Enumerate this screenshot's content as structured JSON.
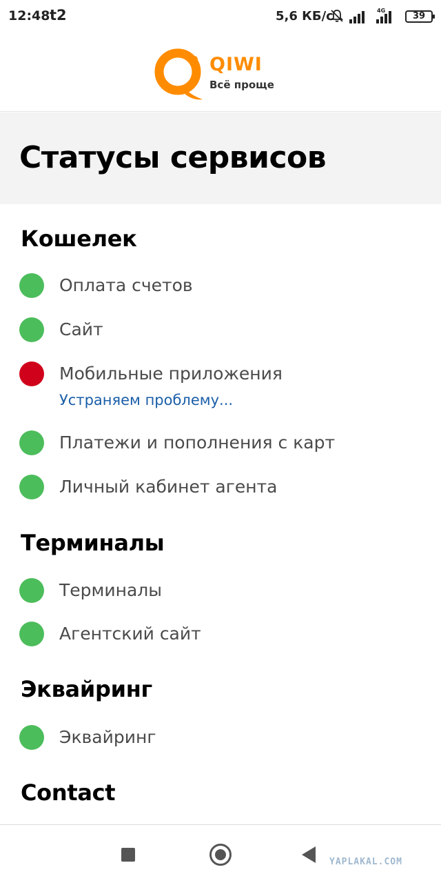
{
  "status_bar": {
    "time": "12:48",
    "carrier": "t2",
    "speed": "5,6 КБ/с",
    "network_label": "4G",
    "battery": "39"
  },
  "header": {
    "logo_word": "QIWI",
    "logo_slogan": "Всё проще",
    "brand_color": "#ff8c00"
  },
  "page": {
    "title": "Статусы сервисов"
  },
  "status_colors": {
    "ok": "#4cbd5b",
    "fail": "#d0021b",
    "note": "#1a5ea8"
  },
  "sections": [
    {
      "title": "Кошелек",
      "items": [
        {
          "label": "Оплата счетов",
          "status": "ok"
        },
        {
          "label": "Сайт",
          "status": "ok"
        },
        {
          "label": "Мобильные приложения",
          "status": "fail",
          "note": "Устраняем проблему..."
        },
        {
          "label": "Платежи и пополнения с карт",
          "status": "ok"
        },
        {
          "label": "Личный кабинет агента",
          "status": "ok"
        }
      ]
    },
    {
      "title": "Терминалы",
      "items": [
        {
          "label": "Терминалы",
          "status": "ok"
        },
        {
          "label": "Агентский сайт",
          "status": "ok"
        }
      ]
    },
    {
      "title": "Эквайринг",
      "items": [
        {
          "label": "Эквайринг",
          "status": "ok"
        }
      ]
    },
    {
      "title": "Contact",
      "items": []
    }
  ],
  "navbar": {
    "watermark": "YAPLAKAL.COM"
  }
}
